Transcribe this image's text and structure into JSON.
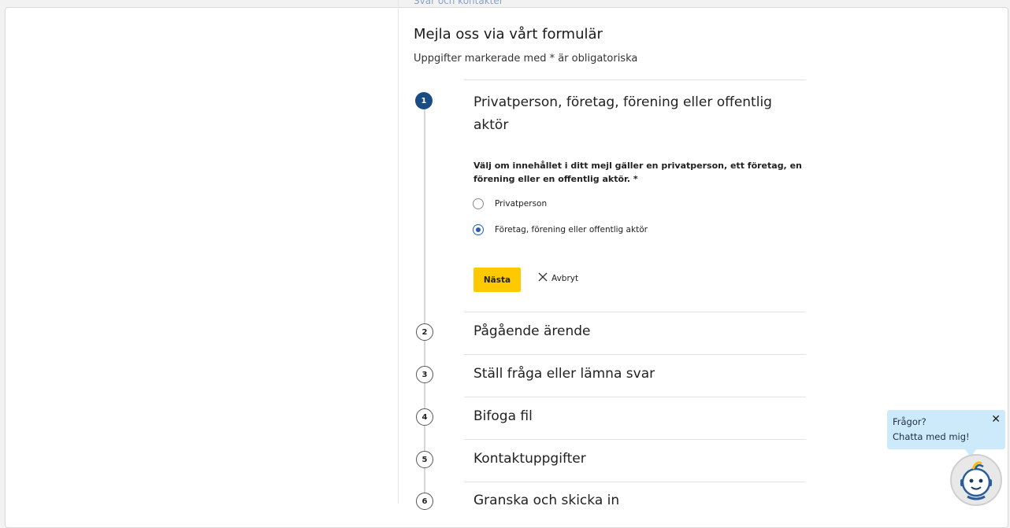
{
  "top_link": "Svar och kontakter",
  "form": {
    "title": "Mejla oss via vårt formulär",
    "subtitle": "Uppgifter markerade med * är obligatoriska"
  },
  "steps": [
    {
      "number": "1",
      "title": "Privatperson, företag, förening eller offentlig aktör",
      "active": true
    },
    {
      "number": "2",
      "title": "Pågående ärende",
      "active": false
    },
    {
      "number": "3",
      "title": "Ställ fråga eller lämna svar",
      "active": false
    },
    {
      "number": "4",
      "title": "Bifoga fil",
      "active": false
    },
    {
      "number": "5",
      "title": "Kontaktuppgifter",
      "active": false
    },
    {
      "number": "6",
      "title": "Granska och skicka in",
      "active": false
    }
  ],
  "step1": {
    "question": "Välj om innehållet i ditt mejl gäller en privatperson, ett företag, en förening eller en offentlig aktör. *",
    "options": [
      {
        "label": "Privatperson",
        "checked": false
      },
      {
        "label": "Företag, förening eller offentlig aktör",
        "checked": true
      }
    ],
    "next_label": "Nästa",
    "cancel_label": "Avbryt"
  },
  "chat": {
    "line1": "Frågor?",
    "line2": "Chatta med mig!",
    "close_glyph": "✕"
  },
  "colors": {
    "active_step": "#1b4b84",
    "next_button": "#ffc900",
    "radio_checked": "#1f5fb3",
    "chat_bubble": "#cdeafa"
  },
  "icons": {
    "cancel": "close-icon",
    "chat_close": "close-icon",
    "chat_avatar": "chatbot-avatar-icon"
  }
}
